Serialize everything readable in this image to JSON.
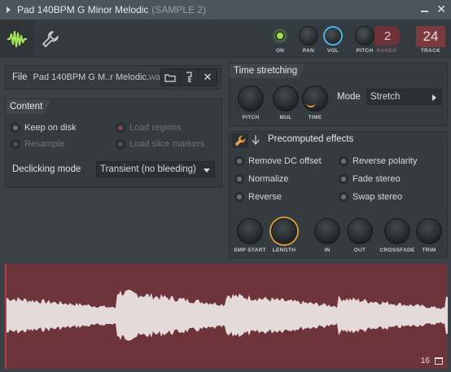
{
  "titlebar": {
    "title": "Pad 140BPM G Minor Melodic",
    "subtitle": "(SAMPLE 2)"
  },
  "toolbar": {
    "tabs": [
      {
        "icon": "waveform-icon",
        "active": true
      },
      {
        "icon": "wrench-icon",
        "active": false
      }
    ],
    "on_label": "ON",
    "pan_label": "PAN",
    "vol_label": "VOL",
    "pitch_label": "PITCH",
    "range_label": "RANGE",
    "range_value": "2",
    "track_label": "TRACK",
    "track_value": "24",
    "accent_color": "#9de04a"
  },
  "file": {
    "label": "File",
    "name": "Pad 140BPM G M..r Melodic",
    "ext": "wav"
  },
  "content": {
    "title": "Content",
    "keep_on_disk": "Keep on disk",
    "resample": "Resample",
    "load_regions": "Load regions",
    "load_slice_markers": "Load slice markers",
    "declicking_label": "Declicking mode",
    "declicking_value": "Transient (no bleeding)"
  },
  "time_stretching": {
    "title": "Time stretching",
    "pitch_label": "PITCH",
    "mul_label": "MUL",
    "time_label": "TIME",
    "mode_label": "Mode",
    "mode_value": "Stretch"
  },
  "precomputed": {
    "title": "Precomputed effects",
    "remove_dc": "Remove DC offset",
    "normalize": "Normalize",
    "reverse": "Reverse",
    "reverse_polarity": "Reverse polarity",
    "fade_stereo": "Fade stereo",
    "swap_stereo": "Swap stereo",
    "smp_start_label": "SMP START",
    "length_label": "LENGTH",
    "in_label": "IN",
    "out_label": "OUT",
    "crossfade_label": "CROSSFADE",
    "trim_label": "TRIM"
  },
  "waveform": {
    "count": "16",
    "background": "#6e343b",
    "wave_color": "#e4dada"
  }
}
